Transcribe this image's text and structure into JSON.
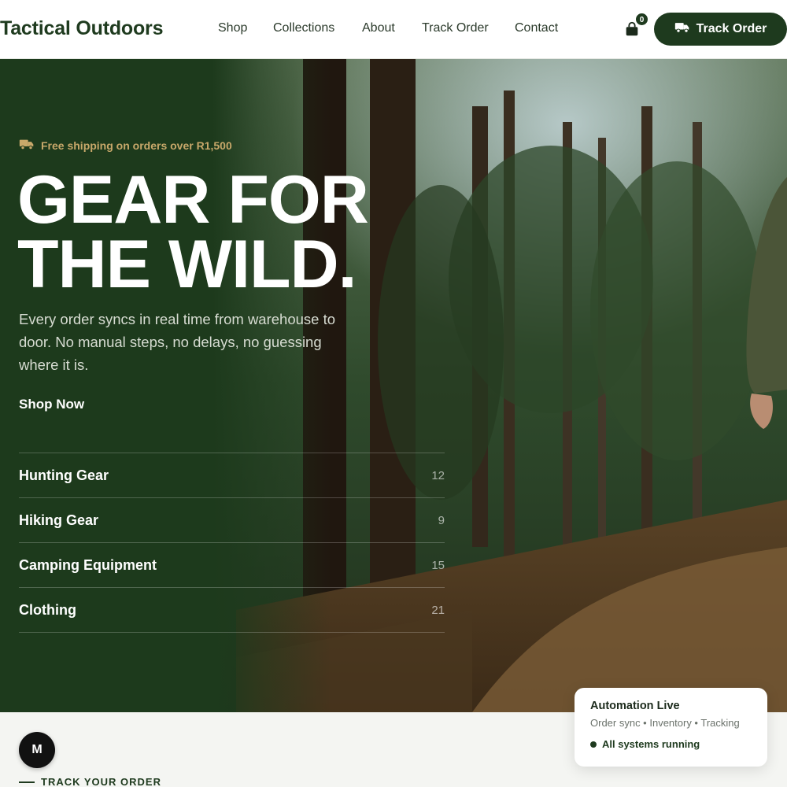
{
  "nav": {
    "brand": "Tactical Outdoors",
    "links": [
      "Shop",
      "Collections",
      "About",
      "Track Order",
      "Contact"
    ],
    "cart_count": "0",
    "cart_icon": "shopping-bag-icon",
    "cta_label": "Track Order",
    "cta_icon": "truck-icon"
  },
  "hero": {
    "promo_text": "Free shipping on orders over R1,500",
    "promo_icon": "truck-icon",
    "headline_line1": "GEAR FOR",
    "headline_line2": "THE WILD.",
    "subtext": "Every order syncs in real time from warehouse to door. No manual steps, no delays, no guessing where it is.",
    "shop_now": "Shop Now",
    "categories": [
      {
        "name": "Hunting Gear",
        "count": "12"
      },
      {
        "name": "Hiking Gear",
        "count": "9"
      },
      {
        "name": "Camping Equipment",
        "count": "15"
      },
      {
        "name": "Clothing",
        "count": "21"
      }
    ]
  },
  "status_card": {
    "title": "Automation Live",
    "subtitle": "Order sync • Inventory • Tracking",
    "state": "All systems running"
  },
  "avatar_initial": "M",
  "track_section_heading": "TRACK YOUR ORDER",
  "colors": {
    "brand_green": "#1e3a1e",
    "accent_gold": "#c8a86a",
    "page_bg": "#f4f5f2"
  }
}
